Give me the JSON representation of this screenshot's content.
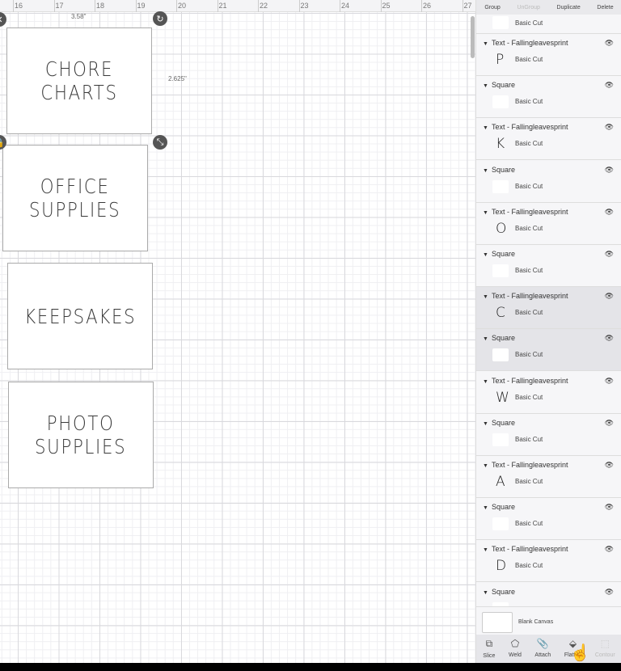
{
  "ruler": {
    "ticks": [
      "16",
      "17",
      "18",
      "19",
      "20",
      "21",
      "22",
      "23",
      "24",
      "25",
      "26",
      "27"
    ]
  },
  "canvas": {
    "dimension_width": "3.58\"",
    "dimension_height": "2.625\"",
    "cards": [
      {
        "text": "CHORE\nCHARTS",
        "selected": true
      },
      {
        "text": "OFFICE\nSUPPLIES",
        "selected": false
      },
      {
        "text": "KEEPSAKES",
        "selected": false
      },
      {
        "text": "PHOTO\nSUPPLIES",
        "selected": false
      }
    ]
  },
  "panel": {
    "toolbar": {
      "group": "Group",
      "ungroup": "UnGroup",
      "duplicate": "Duplicate",
      "delete": "Delete"
    },
    "top_partial": {
      "cut": "Basic Cut"
    },
    "layers": [
      {
        "name": "Text - Fallingleavesprint",
        "glyph": "P",
        "cut": "Basic Cut",
        "selected": false
      },
      {
        "name": "Square",
        "glyph": "",
        "cut": "Basic Cut",
        "selected": false
      },
      {
        "name": "Text - Fallingleavesprint",
        "glyph": "K",
        "cut": "Basic Cut",
        "selected": false
      },
      {
        "name": "Square",
        "glyph": "",
        "cut": "Basic Cut",
        "selected": false
      },
      {
        "name": "Text - Fallingleavesprint",
        "glyph": "O",
        "cut": "Basic Cut",
        "selected": false
      },
      {
        "name": "Square",
        "glyph": "",
        "cut": "Basic Cut",
        "selected": false
      },
      {
        "name": "Text - Fallingleavesprint",
        "glyph": "C",
        "cut": "Basic Cut",
        "selected": true
      },
      {
        "name": "Square",
        "glyph": "",
        "cut": "Basic Cut",
        "selected": true
      },
      {
        "name": "Text - Fallingleavesprint",
        "glyph": "W",
        "cut": "Basic Cut",
        "selected": false
      },
      {
        "name": "Square",
        "glyph": "",
        "cut": "Basic Cut",
        "selected": false
      },
      {
        "name": "Text - Fallingleavesprint",
        "glyph": "A",
        "cut": "Basic Cut",
        "selected": false
      },
      {
        "name": "Square",
        "glyph": "",
        "cut": "Basic Cut",
        "selected": false
      },
      {
        "name": "Text - Fallingleavesprint",
        "glyph": "D",
        "cut": "Basic Cut",
        "selected": false
      },
      {
        "name": "Square",
        "glyph": "",
        "cut": "",
        "selected": false
      }
    ],
    "blank_canvas": "Blank Canvas",
    "tools": [
      {
        "label": "Slice",
        "icon": "slice-icon",
        "enabled": true
      },
      {
        "label": "Weld",
        "icon": "weld-icon",
        "enabled": true
      },
      {
        "label": "Attach",
        "icon": "attach-icon",
        "enabled": true
      },
      {
        "label": "Flatten",
        "icon": "flatten-icon",
        "enabled": true
      },
      {
        "label": "Contour",
        "icon": "contour-icon",
        "enabled": false
      }
    ]
  }
}
